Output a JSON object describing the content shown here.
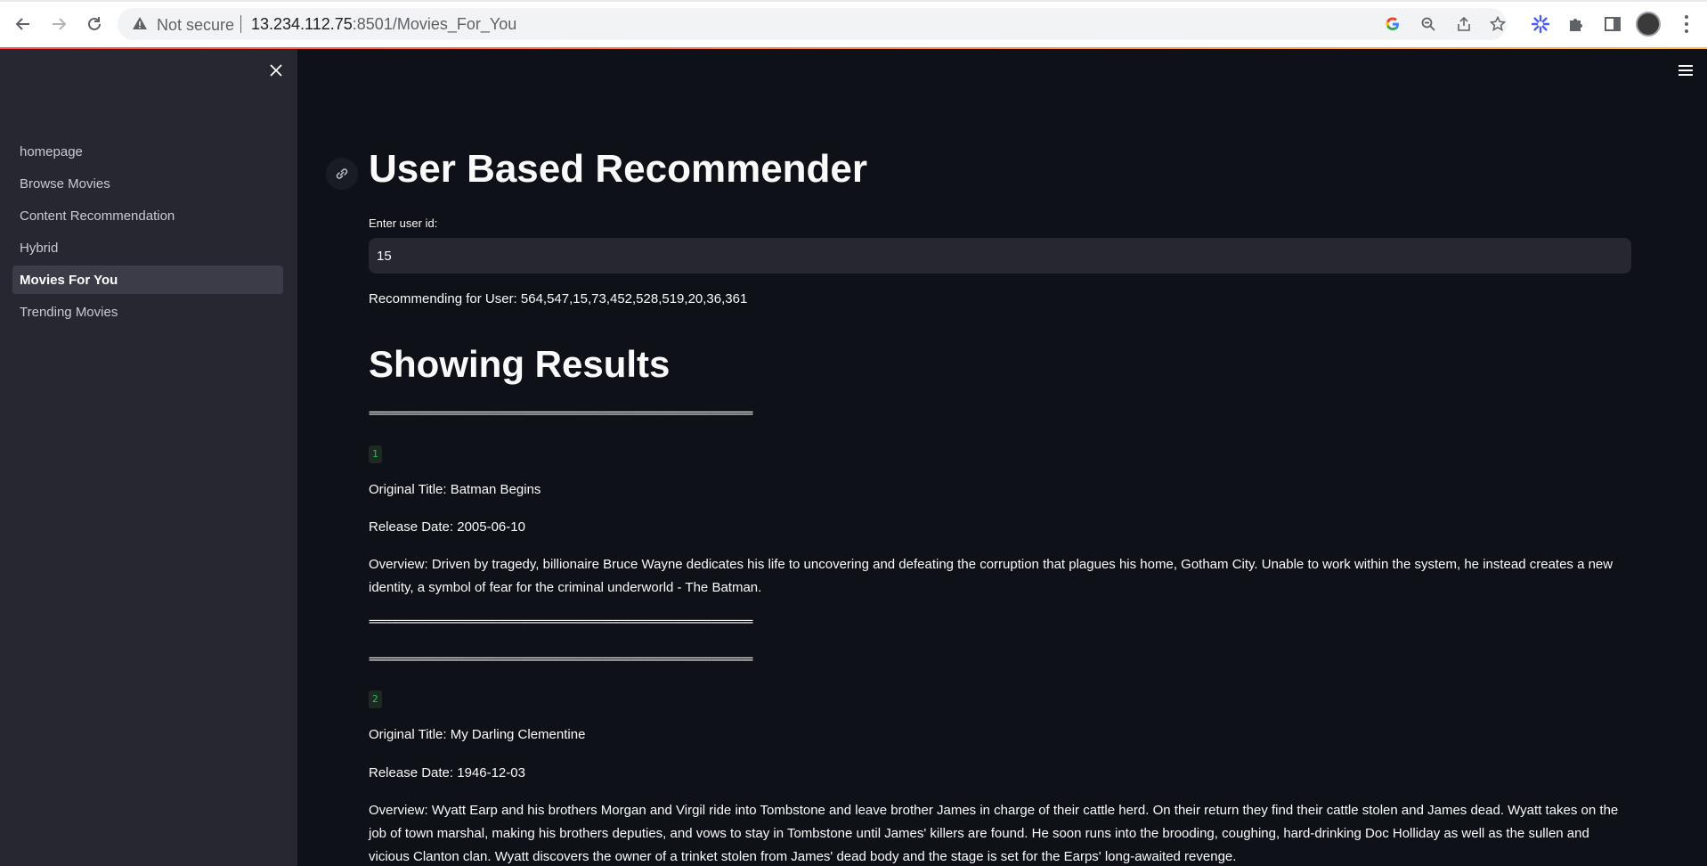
{
  "browser": {
    "security_label": "Not secure",
    "url_host": "13.234.112.75",
    "url_rest": ":8501/Movies_For_You"
  },
  "sidebar": {
    "items": [
      {
        "label": "homepage",
        "active": false
      },
      {
        "label": "Browse Movies",
        "active": false
      },
      {
        "label": "Content Recommendation",
        "active": false
      },
      {
        "label": "Hybrid",
        "active": false
      },
      {
        "label": "Movies For You",
        "active": true
      },
      {
        "label": "Trending Movies",
        "active": false
      }
    ]
  },
  "main": {
    "title": "User Based Recommender",
    "input_label": "Enter user id:",
    "input_value": "15",
    "recommending_text": "Recommending for User: 564,547,15,73,452,528,519,20,36,361",
    "results_title": "Showing Results",
    "separator": "==================================================================",
    "results": [
      {
        "index": "1",
        "title": "Original Title: Batman Begins",
        "release": "Release Date: 2005-06-10",
        "overview": "Overview: Driven by tragedy, billionaire Bruce Wayne dedicates his life to uncovering and defeating the corruption that plagues his home, Gotham City. Unable to work within the system, he instead creates a new identity, a symbol of fear for the criminal underworld - The Batman."
      },
      {
        "index": "2",
        "title": "Original Title: My Darling Clementine",
        "release": "Release Date: 1946-12-03",
        "overview": "Overview: Wyatt Earp and his brothers Morgan and Virgil ride into Tombstone and leave brother James in charge of their cattle herd. On their return they find their cattle stolen and James dead. Wyatt takes on the job of town marshal, making his brothers deputies, and vows to stay in Tombstone until James' killers are found. He soon runs into the brooding, coughing, hard-drinking Doc Holliday as well as the sullen and vicious Clanton clan. Wyatt discovers the owner of a trinket stolen from James' dead body and the stage is set for the Earps' long-awaited revenge."
      }
    ]
  },
  "colors": {
    "app_bg": "#0e1117",
    "sidebar_bg": "#262730",
    "badge_text": "#21c354",
    "decoration_start": "#ff4b4b",
    "decoration_end": "#ffbd45"
  },
  "icons": [
    "back-arrow-icon",
    "forward-arrow-icon",
    "reload-icon",
    "warning-icon",
    "google-icon",
    "zoom-icon",
    "share-icon",
    "star-icon",
    "extension-icon",
    "puzzle-icon",
    "side-panel-icon",
    "kebab-menu-icon",
    "close-icon",
    "link-icon",
    "hamburger-menu-icon"
  ]
}
